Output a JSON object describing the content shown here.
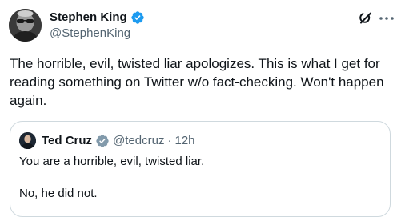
{
  "author": {
    "display_name": "Stephen King",
    "handle": "@StephenKing",
    "verified": true,
    "avatar_icon": "author-avatar"
  },
  "tweet": {
    "text": "The horrible, evil, twisted liar apologizes. This is what I get for reading something on Twitter w/o fact-checking. Won't happen again."
  },
  "actions": {
    "grok_icon": "grok-icon",
    "more_icon": "more-options-icon"
  },
  "quoted_tweet": {
    "display_name": "Ted Cruz",
    "handle": "@tedcruz",
    "separator": "·",
    "time": "12h",
    "verified": true,
    "verified_color": "#829aab",
    "lines": [
      "You are a horrible, evil, twisted liar.",
      "No, he did not."
    ]
  },
  "colors": {
    "primary_text": "#0f1419",
    "secondary_text": "#536471",
    "verified_blue": "#1d9bf0",
    "border": "#cfd9de"
  }
}
